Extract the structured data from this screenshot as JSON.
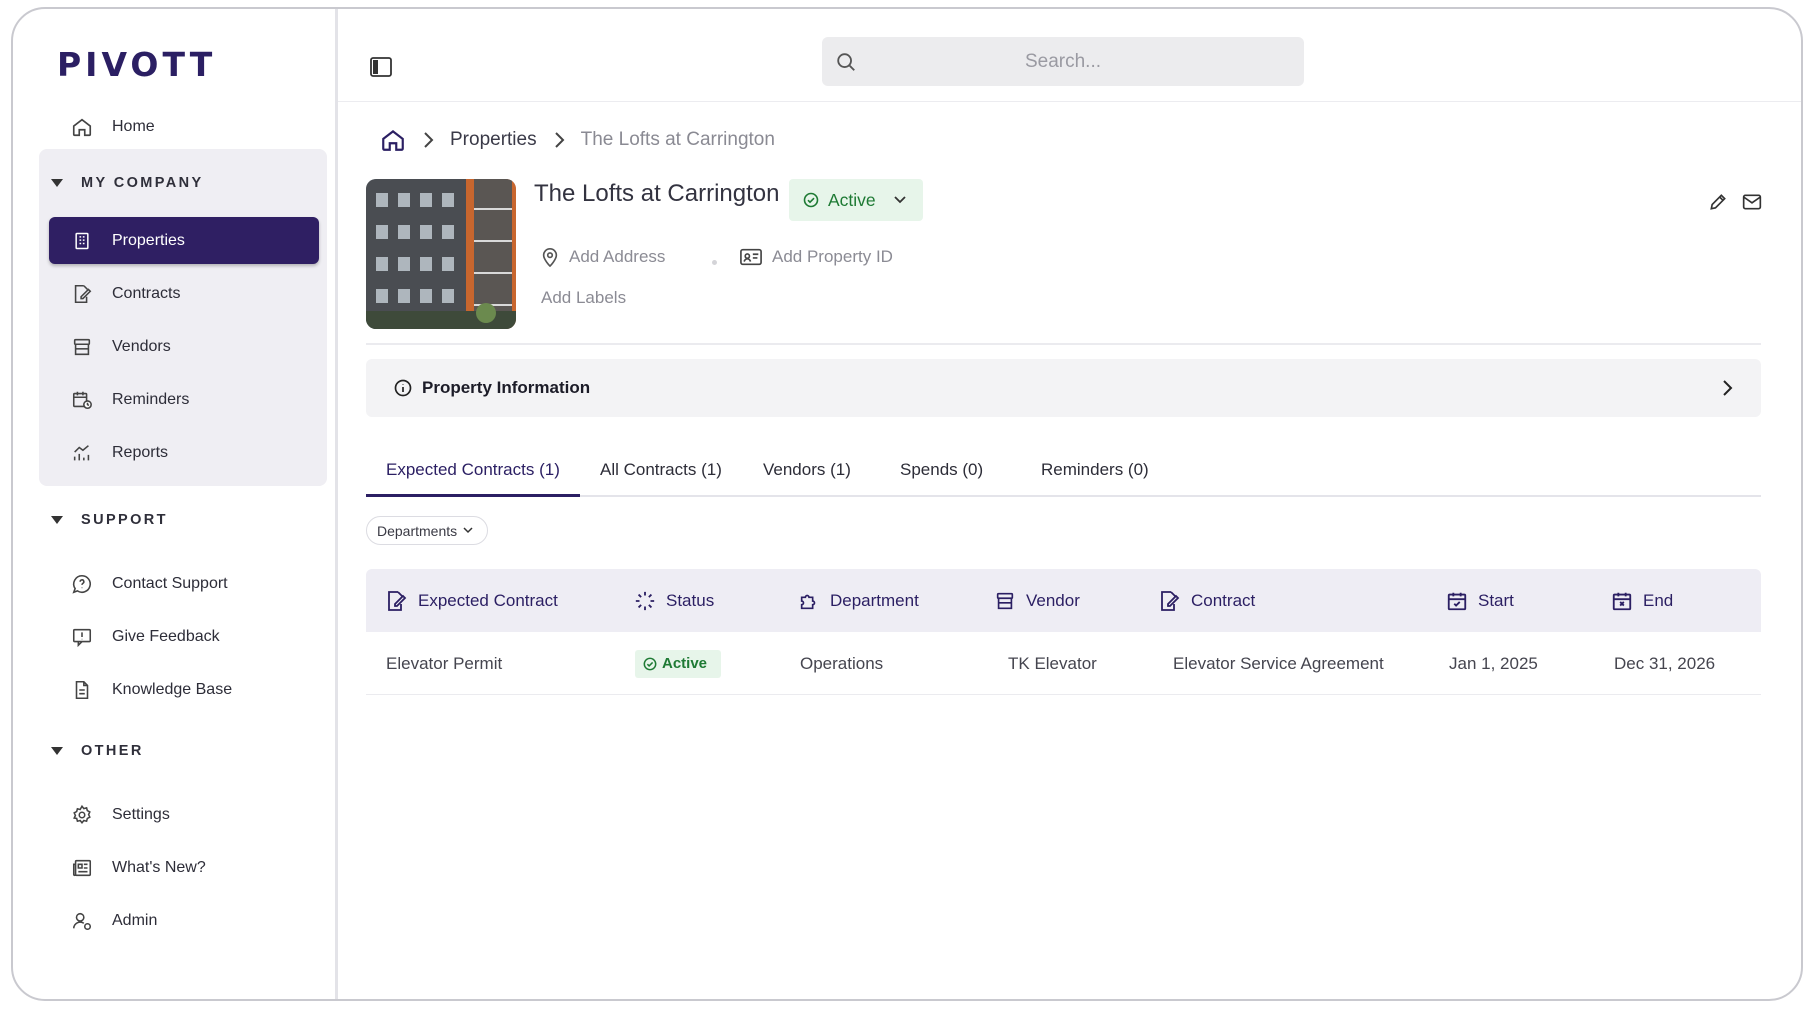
{
  "app": {
    "logo": "PIVOTT"
  },
  "sidebar": {
    "home": "Home",
    "sections": [
      {
        "title": "MY COMPANY",
        "items": [
          "Properties",
          "Contracts",
          "Vendors",
          "Reminders",
          "Reports"
        ]
      },
      {
        "title": "SUPPORT",
        "items": [
          "Contact Support",
          "Give Feedback",
          "Knowledge Base"
        ]
      },
      {
        "title": "OTHER",
        "items": [
          "Settings",
          "What's New?",
          "Admin"
        ]
      }
    ],
    "active_item": "Properties"
  },
  "search": {
    "placeholder": "Search..."
  },
  "breadcrumb": {
    "items": [
      "Properties",
      "The Lofts at Carrington"
    ]
  },
  "property": {
    "title": "The Lofts at Carrington",
    "status": "Active",
    "add_address": "Add Address",
    "add_property_id": "Add Property ID",
    "add_labels": "Add Labels"
  },
  "property_info": {
    "label": "Property Information"
  },
  "tabs": [
    "Expected Contracts (1)",
    "All Contracts (1)",
    "Vendors (1)",
    "Spends (0)",
    "Reminders (0)"
  ],
  "active_tab": "Expected Contracts (1)",
  "filters": {
    "departments": "Departments"
  },
  "table": {
    "columns": [
      "Expected Contract",
      "Status",
      "Department",
      "Vendor",
      "Contract",
      "Start",
      "End"
    ],
    "rows": [
      [
        "Elevator Permit",
        "Active",
        "Operations",
        "TK Elevator",
        "Elevator Service Agreement",
        "Jan 1, 2025",
        "Dec 31, 2026"
      ]
    ]
  },
  "colors": {
    "brand": "#2f1f63",
    "active_green": "#1e7a34",
    "active_bg": "#e7f5ea"
  }
}
